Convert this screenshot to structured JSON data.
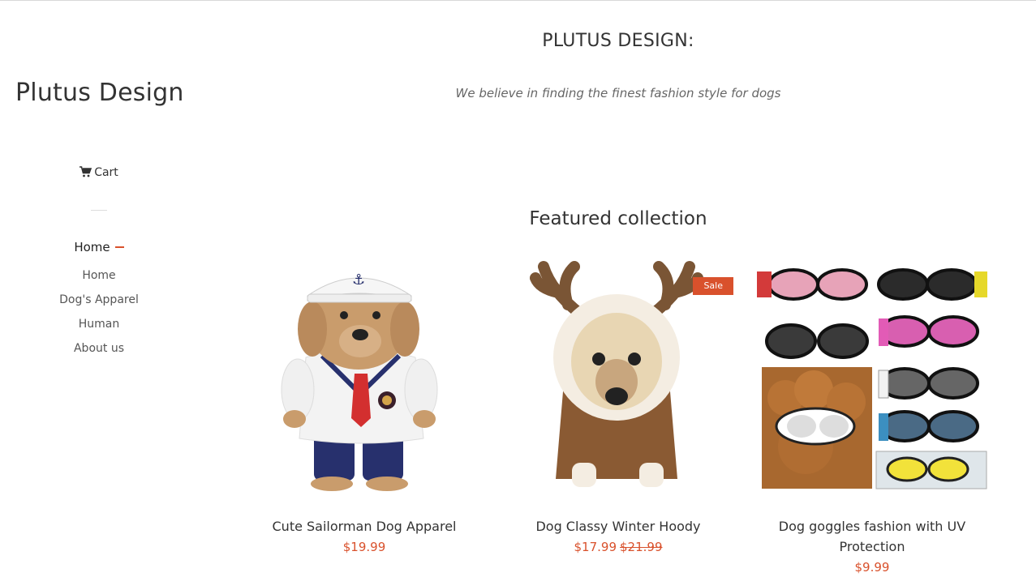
{
  "shop": {
    "name": "Plutus Design",
    "cart_label": "Cart"
  },
  "nav": {
    "parent_label": "Home",
    "items": [
      {
        "label": "Home"
      },
      {
        "label": "Dog's Apparel"
      },
      {
        "label": "Human"
      },
      {
        "label": "About us"
      }
    ]
  },
  "hero": {
    "title": "PLUTUS DESIGN:",
    "subtitle": "We believe in finding the finest fashion style for dogs"
  },
  "featured": {
    "title": "Featured collection",
    "products": [
      {
        "name": "Cute Sailorman Dog Apparel",
        "price": "$19.99",
        "compare_price": "",
        "badge": ""
      },
      {
        "name": "Dog Classy Winter Hoody",
        "price": "$17.99",
        "compare_price": "$21.99",
        "badge": "Sale"
      },
      {
        "name": "Dog goggles fashion with UV Protection",
        "price": "$9.99",
        "compare_price": "",
        "badge": ""
      }
    ]
  },
  "colors": {
    "accent": "#d9512c",
    "text": "#333333"
  }
}
